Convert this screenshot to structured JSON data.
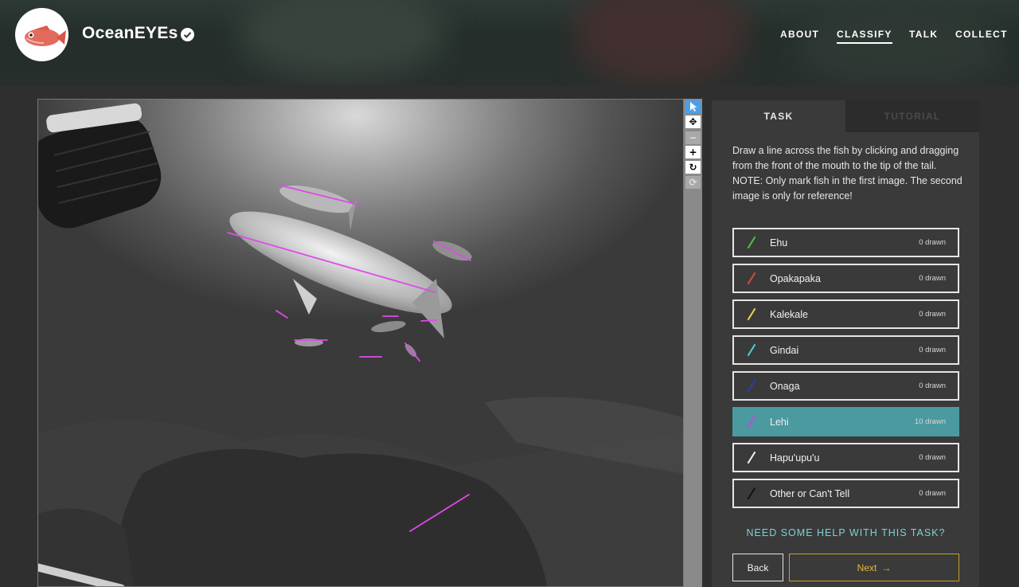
{
  "header": {
    "project_title": "OceanEYEs",
    "verified_icon": "check-badge-icon",
    "nav": [
      {
        "label": "ABOUT",
        "active": false
      },
      {
        "label": "CLASSIFY",
        "active": true
      },
      {
        "label": "TALK",
        "active": false
      },
      {
        "label": "COLLECT",
        "active": false
      }
    ]
  },
  "toolbar": {
    "tools": [
      {
        "name": "pointer-icon",
        "glyph": "➤",
        "state": "active"
      },
      {
        "name": "pan-icon",
        "glyph": "✥",
        "state": "normal"
      },
      {
        "name": "zoom-out-icon",
        "glyph": "−",
        "state": "disabled"
      },
      {
        "name": "zoom-in-icon",
        "glyph": "+",
        "state": "normal"
      },
      {
        "name": "rotate-icon",
        "glyph": "↻",
        "state": "normal"
      },
      {
        "name": "reset-icon",
        "glyph": "⟳",
        "state": "disabled"
      }
    ]
  },
  "task": {
    "tabs": {
      "task": "TASK",
      "tutorial": "TUTORIAL"
    },
    "instructions": [
      "Draw a line across the fish by clicking and dragging from the front of the mouth to the tip of the tail.",
      "NOTE: Only mark fish in the first image. The second image is only for reference!"
    ],
    "choices": [
      {
        "label": "Ehu",
        "count": "0 drawn",
        "color": "#4fbf4f",
        "selected": false
      },
      {
        "label": "Opakapaka",
        "count": "0 drawn",
        "color": "#d94a3a",
        "selected": false
      },
      {
        "label": "Kalekale",
        "count": "0 drawn",
        "color": "#e3d54a",
        "selected": false
      },
      {
        "label": "Gindai",
        "count": "0 drawn",
        "color": "#4fd0d0",
        "selected": false
      },
      {
        "label": "Onaga",
        "count": "0 drawn",
        "color": "#2a3fb0",
        "selected": false
      },
      {
        "label": "Lehi",
        "count": "10 drawn",
        "color": "#c04ad8",
        "selected": true
      },
      {
        "label": "Hapu'upu'u",
        "count": "0 drawn",
        "color": "#f0f0f0",
        "selected": false
      },
      {
        "label": "Other or Can't Tell",
        "count": "0 drawn",
        "color": "#111111",
        "selected": false
      }
    ],
    "help_link": "NEED SOME HELP WITH THIS TASK?",
    "back_label": "Back",
    "next_label": "Next",
    "next_arrow": "→"
  },
  "annotation_color": "#e04ae8"
}
